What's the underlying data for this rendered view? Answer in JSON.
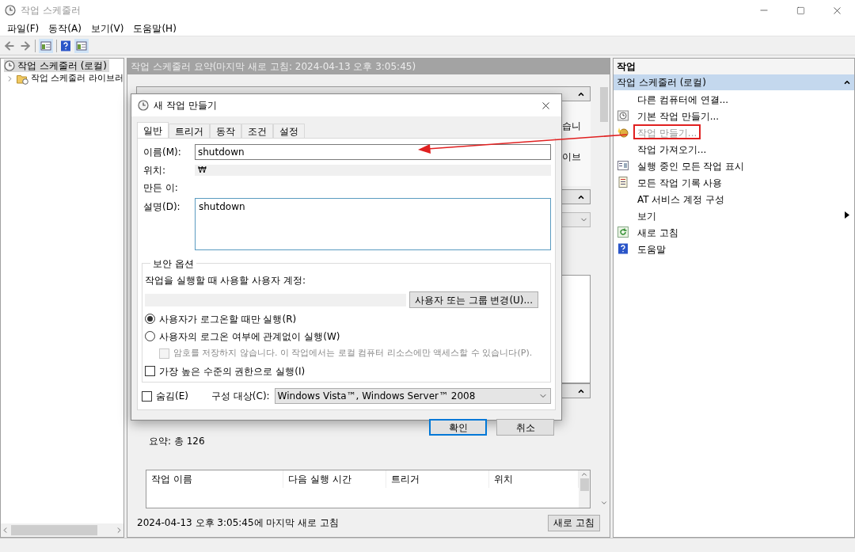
{
  "window": {
    "title": "작업 스케줄러"
  },
  "menu": [
    {
      "label": "파일(F)"
    },
    {
      "label": "동작(A)"
    },
    {
      "label": "보기(V)"
    },
    {
      "label": "도움말(H)"
    }
  ],
  "tree": [
    {
      "label": "작업 스케줄러 (로컬)",
      "selected": true,
      "children": [
        {
          "label": "작업 스케줄러 라이브러",
          "selected": false,
          "expanded": false
        }
      ]
    }
  ],
  "summary": {
    "header": "작업 스케줄러 요약(마지막 새로 고침: 2024-04-13 오후 3:05:45)",
    "fragments": [
      "습니",
      "이브"
    ],
    "total": "요약: 총 126",
    "table_columns": [
      "작업 이름",
      "다음 실행 시간",
      "트리거",
      "위치"
    ],
    "status": "2024-04-13 오후 3:05:45에 마지막 새로 고침",
    "refresh_button": "새로 고침"
  },
  "actions": {
    "title": "작업",
    "group": "작업 스케줄러 (로컬)",
    "items": [
      {
        "label": "다른 컴퓨터에 연결...",
        "kind": "action",
        "disabled": false,
        "annotated": false
      },
      {
        "label": "기본 작업 만들기...",
        "kind": "action",
        "disabled": false,
        "annotated": false
      },
      {
        "label": "작업 만들기...",
        "kind": "action",
        "disabled": true,
        "annotated": true
      },
      {
        "label": "작업 가져오기...",
        "kind": "action",
        "disabled": false,
        "annotated": false
      },
      {
        "label": "실행 중인 모든 작업 표시",
        "kind": "action",
        "disabled": false,
        "annotated": false
      },
      {
        "label": "모든 작업 기록 사용",
        "kind": "action",
        "disabled": false,
        "annotated": false
      },
      {
        "label": "AT 서비스 계정 구성",
        "kind": "action",
        "disabled": false,
        "annotated": false
      },
      {
        "label": "보기",
        "kind": "submenu",
        "disabled": false,
        "annotated": false
      },
      {
        "label": "새로 고침",
        "kind": "action",
        "disabled": false,
        "annotated": false
      },
      {
        "label": "도움말",
        "kind": "action",
        "disabled": false,
        "annotated": false
      }
    ]
  },
  "dialog": {
    "title": "새 작업 만들기",
    "tabs": [
      {
        "label": "일반",
        "selected": true
      },
      {
        "label": "트리거",
        "selected": false
      },
      {
        "label": "동작",
        "selected": false
      },
      {
        "label": "조건",
        "selected": false
      },
      {
        "label": "설정",
        "selected": false
      }
    ],
    "name": {
      "label": "이름(M):",
      "value": "shutdown"
    },
    "location": {
      "label": "위치:",
      "value": "₩"
    },
    "author": {
      "label": "만든 이:"
    },
    "description": {
      "label": "설명(D):",
      "value": "shutdown"
    },
    "security": {
      "legend": "보안 옵션",
      "account_label": "작업을 실행할 때 사용할 사용자 계정:",
      "change_button": "사용자 또는 그룹 변경(U)...",
      "radios": [
        {
          "label": "사용자가 로그온할 때만 실행(R)",
          "selected": true
        },
        {
          "label": "사용자의 로그온 여부에 관계없이 실행(W)",
          "selected": false
        }
      ],
      "no_password": {
        "label": "암호를 저장하지 않습니다. 이 작업에서는 로컬 컴퓨터 리소스에만 액세스할 수 있습니다(P).",
        "checked": false,
        "disabled": true
      },
      "highest": {
        "label": "가장 높은 수준의 권한으로 실행(I)",
        "checked": false,
        "disabled": false
      }
    },
    "hidden": {
      "label": "숨김(E)",
      "checked": false
    },
    "configure": {
      "label": "구성 대상(C):",
      "value": "Windows Vista™, Windows Server™ 2008"
    },
    "ok_button": "확인",
    "cancel_button": "취소"
  }
}
